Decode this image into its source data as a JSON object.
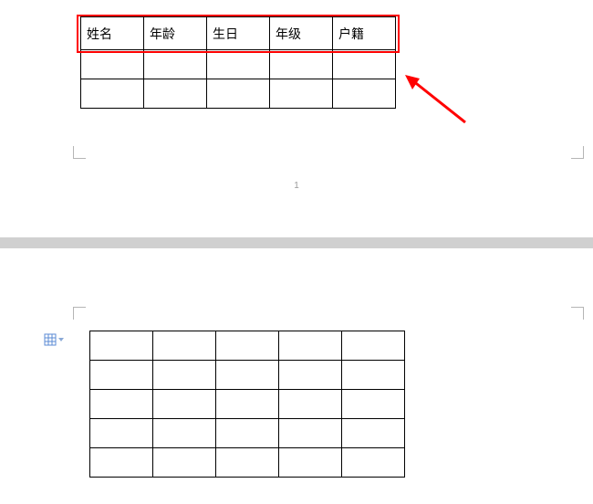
{
  "page1": {
    "page_number": "1",
    "table": {
      "headers": [
        "姓名",
        "年龄",
        "生日",
        "年级",
        "户籍"
      ],
      "body_rows": 2,
      "cols": 5
    },
    "highlight": true
  },
  "page2": {
    "table": {
      "rows": 5,
      "cols": 5
    },
    "table_options_icon": "table-icon"
  },
  "annotation": {
    "arrow_color": "#ff0000"
  }
}
